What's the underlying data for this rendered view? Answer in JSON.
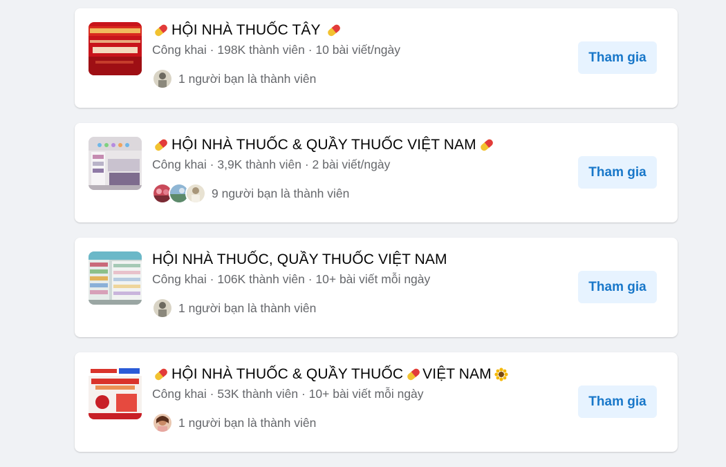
{
  "colors": {
    "background": "#f0f2f5",
    "card": "#ffffff",
    "button_bg": "#e7f3ff",
    "button_text": "#1877c9",
    "meta_text": "#65676b"
  },
  "groups": [
    {
      "thumb_icon": "group-photo-red-banner",
      "title_prefix_icon": "pill-icon",
      "title": "HỘI NHÀ THUỐC TÂY",
      "title_suffix_icons": [
        "pill-icon"
      ],
      "meta": "Công khai · 198K thành viên · 10 bài viết/ngày",
      "friends_text": "1 người bạn là thành viên",
      "avatar_count": 1,
      "join_label": "Tham gia"
    },
    {
      "thumb_icon": "group-photo-pharmacy-shelves",
      "title_prefix_icon": "pill-icon",
      "title": "HỘI NHÀ THUỐC & QUẦY THUỐC VIỆT NAM",
      "title_suffix_icons": [
        "pill-icon"
      ],
      "meta": "Công khai · 3,9K thành viên · 2 bài viết/ngày",
      "friends_text": "9 người bạn là thành viên",
      "avatar_count": 3,
      "join_label": "Tham gia"
    },
    {
      "thumb_icon": "group-photo-drugstore-aisle",
      "title_prefix_icon": "",
      "title": "HỘI NHÀ THUỐC, QUẦY THUỐC VIỆT NAM",
      "title_suffix_icons": [],
      "meta": "Công khai · 106K thành viên · 10+ bài viết mỗi ngày",
      "friends_text": "1 người bạn là thành viên",
      "avatar_count": 1,
      "join_label": "Tham gia"
    },
    {
      "thumb_icon": "group-photo-product-ad",
      "title_prefix_icon": "pill-icon",
      "title": "HỘI NHÀ THUỐC & QUẦY THUỐC",
      "title_mid_icon": "pill-icon",
      "title_tail": "VIỆT NAM",
      "title_suffix_icons": [
        "sunflower-icon"
      ],
      "meta": "Công khai · 53K thành viên · 10+ bài viết mỗi ngày",
      "friends_text": "1 người bạn là thành viên",
      "avatar_count": 1,
      "join_label": "Tham gia"
    }
  ]
}
